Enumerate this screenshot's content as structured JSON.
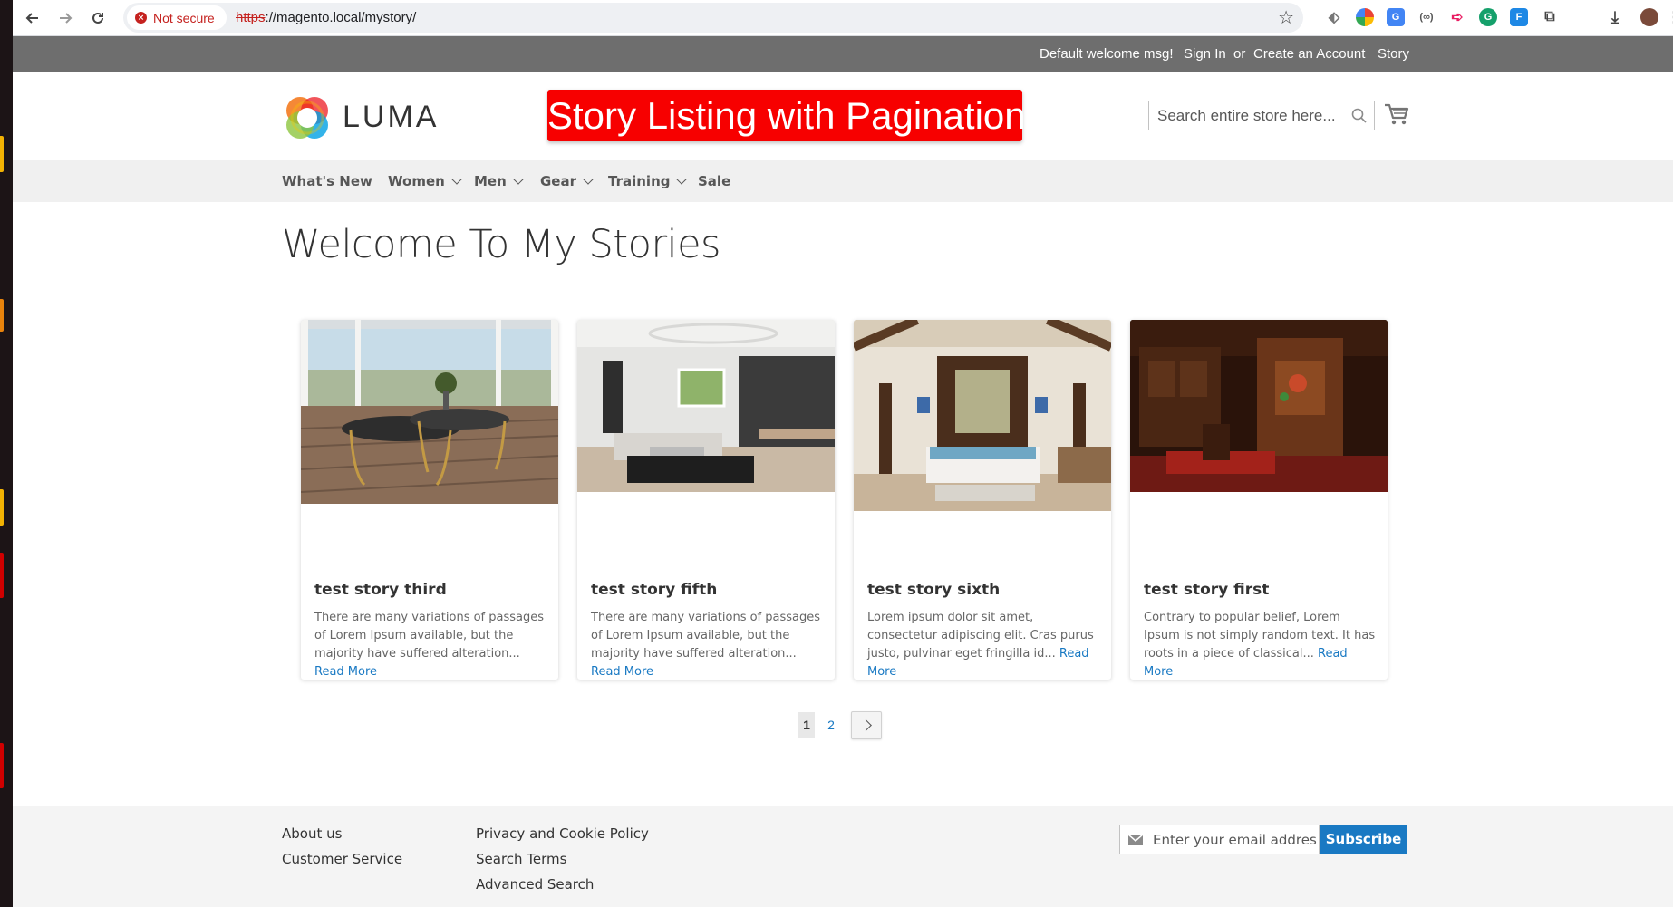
{
  "browser": {
    "security_label": "Not secure",
    "url_scheme": "https",
    "url_rest": "://magento.local/mystory/"
  },
  "panel": {
    "welcome": "Default welcome msg!",
    "sign_in": "Sign In",
    "or": "or",
    "create_account": "Create an Account",
    "story": "Story"
  },
  "header": {
    "logo_text": "LUMA",
    "banner": "Story Listing with Pagination",
    "search_placeholder": "Search entire store here..."
  },
  "nav": {
    "items": [
      {
        "label": "What's New",
        "has_dropdown": false
      },
      {
        "label": "Women",
        "has_dropdown": true
      },
      {
        "label": "Men",
        "has_dropdown": true
      },
      {
        "label": "Gear",
        "has_dropdown": true
      },
      {
        "label": "Training",
        "has_dropdown": true
      },
      {
        "label": "Sale",
        "has_dropdown": false
      }
    ]
  },
  "main": {
    "title": "Welcome To My Stories",
    "stories": [
      {
        "title": "test story third",
        "excerpt": "There are many variations of passages of Lorem Ipsum available, but the majority have suffered alteration...",
        "read_more": "Read More"
      },
      {
        "title": "test story fifth",
        "excerpt": "There are many variations of passages of Lorem Ipsum available, but the majority have suffered alteration...",
        "read_more": "Read More"
      },
      {
        "title": "test story sixth",
        "excerpt": "Lorem ipsum dolor sit amet, consectetur adipiscing elit. Cras purus justo, pulvinar eget fringilla id...",
        "read_more": "Read More"
      },
      {
        "title": "test story first",
        "excerpt": "Contrary to popular belief, Lorem Ipsum is not simply random text. It has roots in a piece of classical...",
        "read_more": "Read More"
      }
    ]
  },
  "pagination": {
    "current_page": "1",
    "page_2": "2",
    "next_icon": "chevron-right-icon"
  },
  "footer": {
    "col1": [
      "About us",
      "Customer Service"
    ],
    "col2": [
      "Privacy and Cookie Policy",
      "Search Terms",
      "Advanced Search"
    ],
    "newsletter_placeholder": "Enter your email address",
    "subscribe": "Subscribe"
  },
  "colors": {
    "panel_bg": "#6e6e6e",
    "banner_red": "#f70000",
    "link_blue": "#1979c3",
    "nav_bg": "#f0f0f0",
    "footer_bg": "#f4f4f4"
  }
}
